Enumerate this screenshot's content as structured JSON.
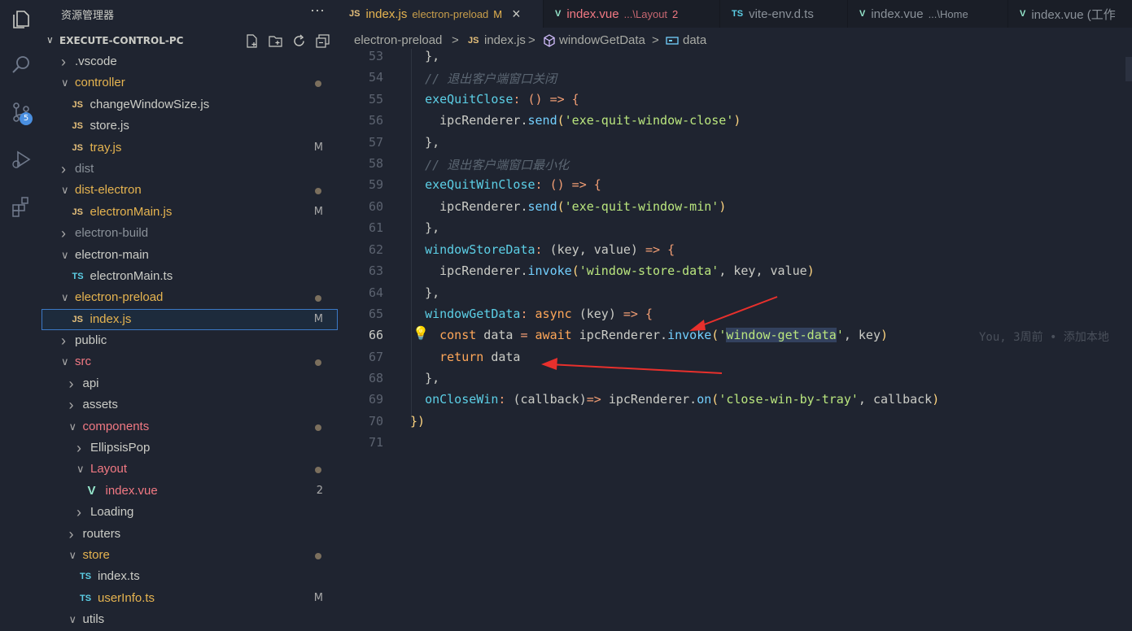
{
  "sidebar": {
    "title": "资源管理器",
    "more": "···",
    "project": "EXECUTE-CONTROL-PC",
    "items": [
      {
        "label": ".vscode",
        "type": "folder",
        "open": false,
        "depth": 0,
        "color": "def"
      },
      {
        "label": "controller",
        "type": "folder",
        "open": true,
        "depth": 0,
        "color": "mod",
        "dot": true
      },
      {
        "label": "changeWindowSize.js",
        "type": "js",
        "depth": 1,
        "color": "def"
      },
      {
        "label": "store.js",
        "type": "js",
        "depth": 1,
        "color": "def"
      },
      {
        "label": "tray.js",
        "type": "js",
        "depth": 1,
        "color": "mod",
        "status": "M"
      },
      {
        "label": "dist",
        "type": "folder",
        "open": false,
        "depth": 0,
        "color": "dim"
      },
      {
        "label": "dist-electron",
        "type": "folder",
        "open": true,
        "depth": 0,
        "color": "mod",
        "dot": true
      },
      {
        "label": "electronMain.js",
        "type": "js",
        "depth": 1,
        "color": "mod",
        "status": "M"
      },
      {
        "label": "electron-build",
        "type": "folder",
        "open": false,
        "depth": 0,
        "color": "dim"
      },
      {
        "label": "electron-main",
        "type": "folder",
        "open": true,
        "depth": 0,
        "color": "def"
      },
      {
        "label": "electronMain.ts",
        "type": "ts",
        "depth": 1,
        "color": "def"
      },
      {
        "label": "electron-preload",
        "type": "folder",
        "open": true,
        "depth": 0,
        "color": "mod",
        "dot": true
      },
      {
        "label": "index.js",
        "type": "js",
        "depth": 1,
        "color": "mod",
        "status": "M",
        "selected": true
      },
      {
        "label": "public",
        "type": "folder",
        "open": false,
        "depth": 0,
        "color": "def"
      },
      {
        "label": "src",
        "type": "folder",
        "open": true,
        "depth": 0,
        "color": "err",
        "dot": true
      },
      {
        "label": "api",
        "type": "folder",
        "open": false,
        "depth": 1,
        "color": "def"
      },
      {
        "label": "assets",
        "type": "folder",
        "open": false,
        "depth": 1,
        "color": "def"
      },
      {
        "label": "components",
        "type": "folder",
        "open": true,
        "depth": 1,
        "color": "err",
        "dot": true
      },
      {
        "label": "EllipsisPop",
        "type": "folder",
        "open": false,
        "depth": 2,
        "color": "def"
      },
      {
        "label": "Layout",
        "type": "folder",
        "open": true,
        "depth": 2,
        "color": "err",
        "dot": true
      },
      {
        "label": "index.vue",
        "type": "vue",
        "depth": 3,
        "color": "err",
        "status": "2"
      },
      {
        "label": "Loading",
        "type": "folder",
        "open": false,
        "depth": 2,
        "color": "def"
      },
      {
        "label": "routers",
        "type": "folder",
        "open": false,
        "depth": 1,
        "color": "def"
      },
      {
        "label": "store",
        "type": "folder",
        "open": true,
        "depth": 1,
        "color": "mod",
        "dot": true
      },
      {
        "label": "index.ts",
        "type": "ts",
        "depth": 2,
        "color": "def"
      },
      {
        "label": "userInfo.ts",
        "type": "ts",
        "depth": 2,
        "color": "mod",
        "status": "M"
      },
      {
        "label": "utils",
        "type": "folder",
        "open": true,
        "depth": 1,
        "color": "def"
      }
    ]
  },
  "activity": {
    "badge": "5"
  },
  "tabs": [
    {
      "icon": "JS",
      "label": "index.js",
      "desc": "electron-preload",
      "status": "M",
      "active": true,
      "close": "×"
    },
    {
      "icon": "V",
      "label": "index.vue",
      "desc": "...\\Layout",
      "status": "2",
      "color": "err"
    },
    {
      "icon": "TS",
      "label": "vite-env.d.ts",
      "desc": "",
      "status": ""
    },
    {
      "icon": "V",
      "label": "index.vue",
      "desc": "...\\Home",
      "status": ""
    },
    {
      "icon": "V",
      "label": "index.vue (工作",
      "desc": "",
      "status": ""
    }
  ],
  "breadcrumb": [
    "electron-preload",
    ">",
    "index.js",
    ">",
    "windowGetData",
    ">",
    "data"
  ],
  "code_lines": [
    {
      "n": "53"
    },
    {
      "n": "54"
    },
    {
      "n": "55"
    },
    {
      "n": "56"
    },
    {
      "n": "57"
    },
    {
      "n": "58"
    },
    {
      "n": "59"
    },
    {
      "n": "60"
    },
    {
      "n": "61"
    },
    {
      "n": "62"
    },
    {
      "n": "63"
    },
    {
      "n": "64"
    },
    {
      "n": "65"
    },
    {
      "n": "66"
    },
    {
      "n": "67"
    },
    {
      "n": "68"
    },
    {
      "n": "69"
    },
    {
      "n": "70"
    },
    {
      "n": "71"
    }
  ],
  "code": {
    "l53": "},",
    "l54": "// 退出客户端窗口关闭",
    "l55_name": "exeQuitClose",
    "l56_str": "'exe-quit-window-close'",
    "l57": "},",
    "l58": "// 退出客户端窗口最小化",
    "l59_name": "exeQuitWinClose",
    "l60_str": "'exe-quit-window-min'",
    "l61": "},",
    "l62_name": "windowStoreData",
    "l63_str": "'window-store-data'",
    "l64": "},",
    "l65_name": "windowGetData",
    "l66_str": "window-get-data",
    "l67": "data",
    "l68": "},",
    "l69_name": "onCloseWin",
    "l69_str": "'close-win-by-tray'",
    "l70": "})",
    "blame": "You, 3周前 • 添加本地"
  }
}
